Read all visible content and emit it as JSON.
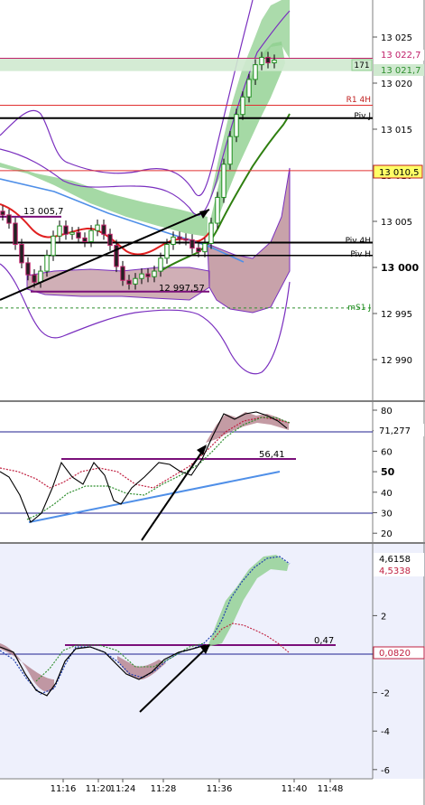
{
  "chart_data": [
    {
      "panel": "price",
      "type": "candlestick",
      "y_axis_ticks": [
        "13 025",
        "13 020",
        "13 015",
        "13 010",
        "13 005",
        "13 000",
        "12 995",
        "12 990"
      ],
      "y_axis_tick_values": [
        13025,
        13020,
        13015,
        13010,
        13005,
        13000,
        12995,
        12990
      ],
      "ylim": [
        12988,
        13029
      ],
      "level_labels": {
        "last_price_top": "13 022,7",
        "last_price_bottom": "13 021,7",
        "box_label": "171",
        "current": "13 010,5",
        "r1_4h": "R1 4H",
        "piv_j": "Piv J",
        "piv_4h": "Piv 4H",
        "piv_h": "Piv H",
        "ms1_j": "mS1 J"
      },
      "levels": {
        "last_price_top": 13022.7,
        "last_price_bottom": 13021.7,
        "r1_4h": 13017.6,
        "piv_j": 13016.2,
        "current": 13010.5,
        "piv_4h": 13002.7,
        "piv_h": 13001.3,
        "ms1_j": 12995.6
      },
      "annotations": [
        "13 005,7",
        "12 997,57"
      ],
      "annotation_values": [
        13005.7,
        12997.57
      ],
      "close": [
        13005.7,
        13004.8,
        13002.5,
        13000.5,
        12999.2,
        12998.4,
        12999.6,
        13001.3,
        13003.4,
        13004.5,
        13003.6,
        13003.8,
        13003.2,
        13002.8,
        13004.0,
        13004.6,
        13003.6,
        13002.4,
        13000.1,
        12998.6,
        12998.2,
        12998.8,
        12999.3,
        12999.0,
        12999.6,
        13001.0,
        13002.5,
        13003.3,
        13003.1,
        13003.0,
        13002.1,
        13001.7,
        13002.6,
        13004.8,
        13007.6,
        13011.2,
        13014.2,
        13016.6,
        13018.5,
        13020.4,
        13022.0,
        13022.8,
        13022.2,
        13022.5
      ]
    },
    {
      "panel": "oscillator_1",
      "type": "line",
      "y_axis_ticks": [
        "80",
        "70",
        "60",
        "50",
        "40",
        "30",
        "20"
      ],
      "y_axis_tick_values": [
        80,
        70,
        60,
        50,
        40,
        30,
        20
      ],
      "ylim": [
        14,
        83
      ],
      "current_value_label": "71,277",
      "annotation": "56,41",
      "annotation_value": 56.41,
      "reference_lines": [
        71.277,
        56.41,
        30
      ]
    },
    {
      "panel": "oscillator_2",
      "type": "line",
      "y_axis_ticks": [
        "2",
        "0",
        "-2",
        "-4",
        "-6"
      ],
      "y_axis_tick_values": [
        2,
        0,
        -2,
        -4,
        -6
      ],
      "ylim": [
        -6.6,
        5.5
      ],
      "current_value_labels": [
        "4,6158",
        "4,5338",
        "0,0820"
      ],
      "current_values": [
        4.6158,
        4.5338,
        0.082
      ],
      "annotation": "0,47",
      "annotation_value": 0.47,
      "reference_lines": [
        0.47,
        0.082
      ]
    },
    {
      "panel": "time_axis",
      "type": "axis",
      "x_ticks": [
        "11:16",
        "11:20",
        "11:24",
        "11:28",
        "11:36",
        "11:40",
        "11:48"
      ]
    }
  ],
  "colors": {
    "background": "#ffffff",
    "panel2_bg": "#ffffff",
    "panel3_bg": "#eef0fc",
    "bollinger": "#7a2fbf",
    "green_band": "#8fcf8f",
    "maroon_band": "#b07a86",
    "up_candle": "#1f8f1f",
    "down_candle": "#c0206a",
    "red_line": "#e02020",
    "blue_line": "#4f8fe8",
    "dark_green": "#2f7f10",
    "arrow": "#000000"
  }
}
